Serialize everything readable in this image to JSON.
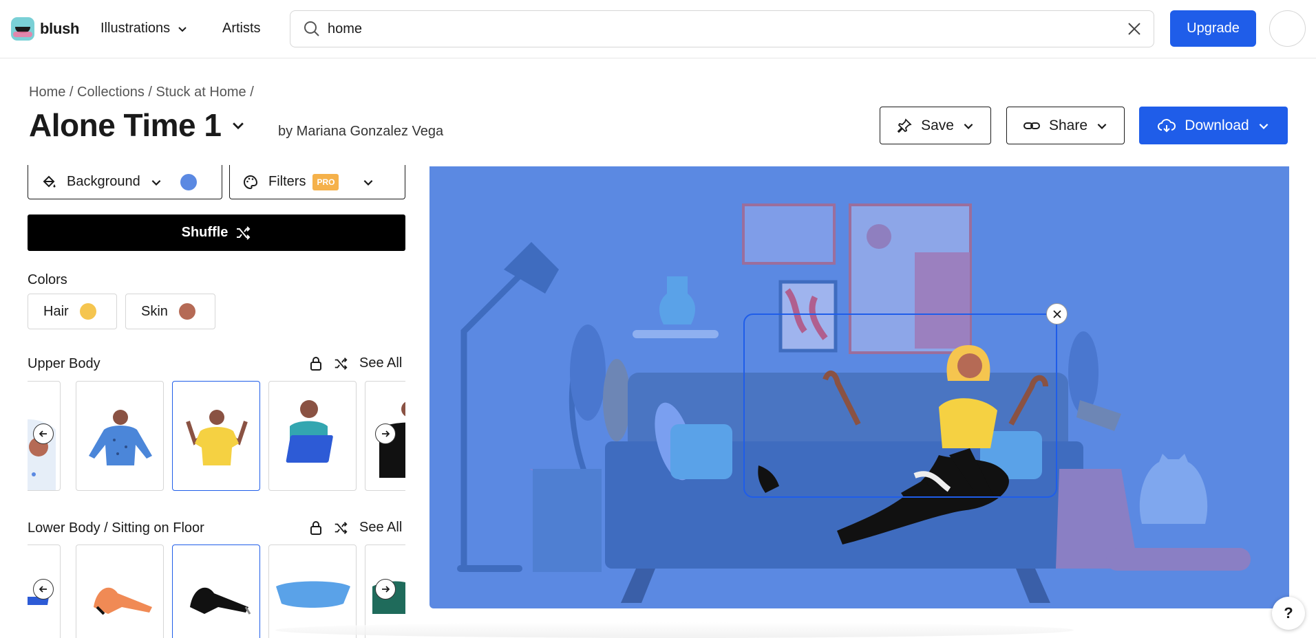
{
  "app": {
    "logo_text": "blush"
  },
  "nav": {
    "illustrations": "Illustrations",
    "artists": "Artists"
  },
  "search": {
    "value": "home",
    "placeholder": ""
  },
  "header": {
    "upgrade": "Upgrade"
  },
  "breadcrumb": "Home / Collections / Stuck at Home /",
  "page": {
    "title": "Alone Time 1",
    "byline": "by Mariana Gonzalez Vega"
  },
  "actions": {
    "save": "Save",
    "share": "Share",
    "download": "Download"
  },
  "options": {
    "background_label": "Background",
    "background_color": "#5b89e2",
    "filters_label": "Filters",
    "pro_badge": "PRO",
    "shuffle": "Shuffle"
  },
  "colors": {
    "label": "Colors",
    "chips": [
      {
        "label": "Hair",
        "color": "#f5c54f"
      },
      {
        "label": "Skin",
        "color": "#b56a55"
      }
    ]
  },
  "upper_body": {
    "label": "Upper Body",
    "see_all": "See All"
  },
  "lower_body": {
    "label": "Lower Body / Sitting on Floor",
    "see_all": "See All"
  },
  "help": "?",
  "colors_theme": {
    "accent": "#1f5de9",
    "canvas": "#5b89e2"
  }
}
